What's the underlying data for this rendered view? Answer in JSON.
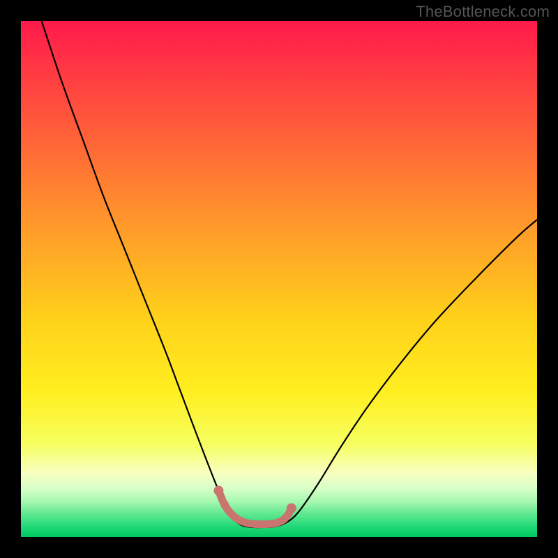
{
  "watermark": "TheBottleneck.com",
  "chart_data": {
    "type": "line",
    "title": "",
    "xlabel": "",
    "ylabel": "",
    "xlim": [
      0,
      100
    ],
    "ylim": [
      0,
      100
    ],
    "grid": false,
    "legend": false,
    "background_gradient_stops": [
      {
        "offset": 0.0,
        "color": "#ff1a4b"
      },
      {
        "offset": 0.2,
        "color": "#ff5a3a"
      },
      {
        "offset": 0.4,
        "color": "#ff9a2a"
      },
      {
        "offset": 0.58,
        "color": "#ffd21a"
      },
      {
        "offset": 0.72,
        "color": "#ffef20"
      },
      {
        "offset": 0.82,
        "color": "#f6ff60"
      },
      {
        "offset": 0.875,
        "color": "#f8ffc0"
      },
      {
        "offset": 0.905,
        "color": "#d8ffc8"
      },
      {
        "offset": 0.93,
        "color": "#a8f8b0"
      },
      {
        "offset": 0.955,
        "color": "#60e890"
      },
      {
        "offset": 0.98,
        "color": "#20d878"
      },
      {
        "offset": 1.0,
        "color": "#00c860"
      }
    ],
    "series": [
      {
        "name": "bottleneck-curve",
        "stroke": "#000000",
        "stroke_width": 2.2,
        "points": [
          {
            "x": 4.0,
            "y": 100.0
          },
          {
            "x": 8.0,
            "y": 88.0
          },
          {
            "x": 12.0,
            "y": 77.0
          },
          {
            "x": 16.0,
            "y": 66.0
          },
          {
            "x": 20.0,
            "y": 56.0
          },
          {
            "x": 24.0,
            "y": 46.0
          },
          {
            "x": 28.0,
            "y": 36.0
          },
          {
            "x": 31.0,
            "y": 28.0
          },
          {
            "x": 34.0,
            "y": 20.0
          },
          {
            "x": 36.5,
            "y": 13.5
          },
          {
            "x": 38.5,
            "y": 8.5
          },
          {
            "x": 40.0,
            "y": 5.2
          },
          {
            "x": 41.5,
            "y": 3.2
          },
          {
            "x": 43.0,
            "y": 2.2
          },
          {
            "x": 45.0,
            "y": 1.9
          },
          {
            "x": 47.0,
            "y": 1.9
          },
          {
            "x": 49.0,
            "y": 2.0
          },
          {
            "x": 51.0,
            "y": 2.6
          },
          {
            "x": 53.0,
            "y": 4.0
          },
          {
            "x": 55.0,
            "y": 6.5
          },
          {
            "x": 58.0,
            "y": 11.0
          },
          {
            "x": 62.0,
            "y": 17.5
          },
          {
            "x": 67.0,
            "y": 25.0
          },
          {
            "x": 73.0,
            "y": 33.0
          },
          {
            "x": 80.0,
            "y": 41.5
          },
          {
            "x": 88.0,
            "y": 50.0
          },
          {
            "x": 96.0,
            "y": 58.0
          },
          {
            "x": 100.0,
            "y": 61.5
          }
        ]
      },
      {
        "name": "valley-marker",
        "stroke": "#c9756f",
        "stroke_width": 11,
        "linecap": "round",
        "points": [
          {
            "x": 38.3,
            "y": 9.0
          },
          {
            "x": 39.2,
            "y": 6.8
          },
          {
            "x": 40.3,
            "y": 5.0
          },
          {
            "x": 41.8,
            "y": 3.6
          },
          {
            "x": 43.5,
            "y": 2.8
          },
          {
            "x": 45.5,
            "y": 2.5
          },
          {
            "x": 47.5,
            "y": 2.5
          },
          {
            "x": 49.3,
            "y": 2.7
          },
          {
            "x": 50.8,
            "y": 3.3
          },
          {
            "x": 51.8,
            "y": 4.4
          },
          {
            "x": 52.4,
            "y": 5.6
          }
        ],
        "end_dots": [
          {
            "x": 38.3,
            "y": 9.0,
            "r": 7
          },
          {
            "x": 39.5,
            "y": 6.2,
            "r": 6
          },
          {
            "x": 52.4,
            "y": 5.6,
            "r": 7
          }
        ]
      }
    ]
  }
}
